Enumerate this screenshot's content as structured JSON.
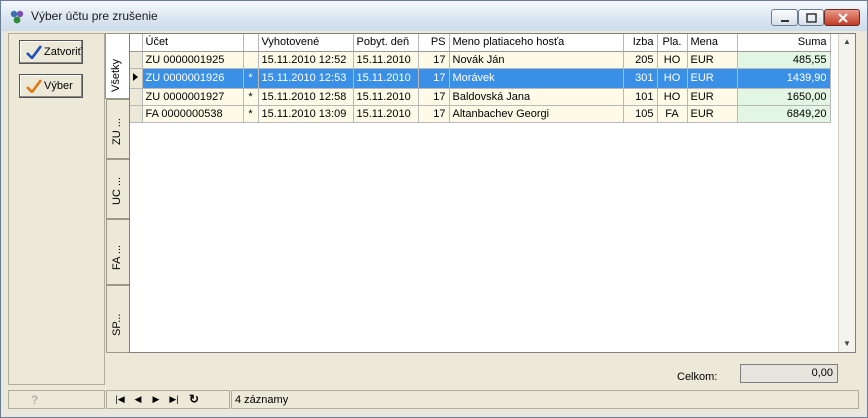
{
  "window": {
    "title": "Výber účtu pre zrušenie",
    "icon": "app-icon"
  },
  "left_panel": {
    "close_label": "Zatvoriť",
    "select_label": "Výber"
  },
  "tabs": [
    {
      "label": "Všetky",
      "active": true
    },
    {
      "label": "ZU ...",
      "active": false
    },
    {
      "label": "UC ...",
      "active": false
    },
    {
      "label": "FA ...",
      "active": false
    },
    {
      "label": "SP...",
      "active": false
    }
  ],
  "grid": {
    "columns": [
      "Účet",
      "",
      "Vyhotovené",
      "Pobyt. deň",
      "PS",
      "Meno platiaceho hosťa",
      "Izba",
      "Pla.",
      "Mena",
      "Suma"
    ],
    "rows": [
      {
        "ucet": "ZU 0000001925",
        "flag": "",
        "vyhotovene": "15.11.2010 12:52",
        "pobyt": "15.11.2010",
        "ps": "17",
        "meno": "Novák Ján",
        "izba": "205",
        "pla": "HO",
        "mena": "EUR",
        "suma": "485,55",
        "selected": false,
        "current": false
      },
      {
        "ucet": "ZU 0000001926",
        "flag": "*",
        "vyhotovene": "15.11.2010 12:53",
        "pobyt": "15.11.2010",
        "ps": "17",
        "meno": "Morávek",
        "izba": "301",
        "pla": "HO",
        "mena": "EUR",
        "suma": "1439,90",
        "selected": true,
        "current": true
      },
      {
        "ucet": "ZU 0000001927",
        "flag": "*",
        "vyhotovene": "15.11.2010 12:58",
        "pobyt": "15.11.2010",
        "ps": "17",
        "meno": "Baldovská Jana",
        "izba": "101",
        "pla": "HO",
        "mena": "EUR",
        "suma": "1650,00",
        "selected": false,
        "current": false
      },
      {
        "ucet": "FA 0000000538",
        "flag": "*",
        "vyhotovene": "15.11.2010 13:09",
        "pobyt": "15.11.2010",
        "ps": "17",
        "meno": "Altanbachev Georgi",
        "izba": "105",
        "pla": "FA",
        "mena": "EUR",
        "suma": "6849,20",
        "selected": false,
        "current": false
      }
    ]
  },
  "totals": {
    "label": "Celkom:",
    "value": "0,00"
  },
  "status": {
    "help": "?",
    "count": "4 záznamy"
  },
  "colors": {
    "selection": "#3a90e6",
    "row_bg": "#fdfbe7",
    "sum_bg": "#e3f6e3"
  }
}
